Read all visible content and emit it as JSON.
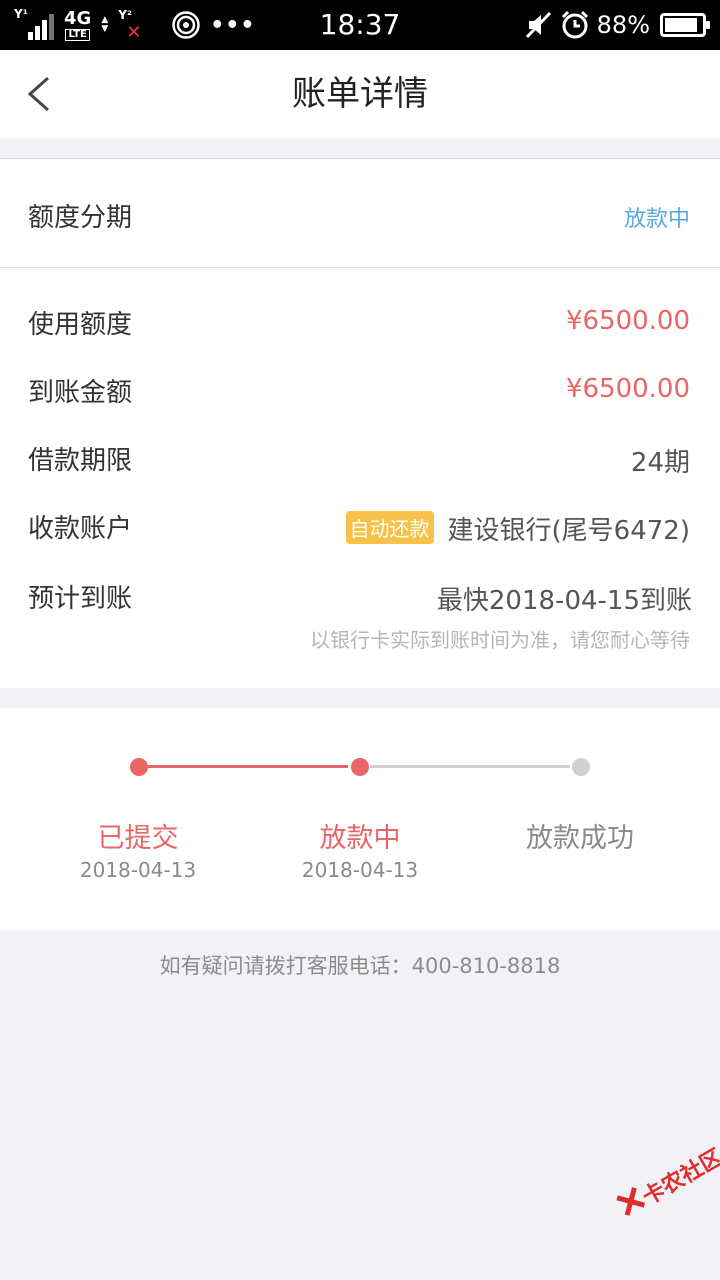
{
  "status_bar": {
    "time": "18:37",
    "network": "4G",
    "network_sub": "LTE",
    "battery": "88%",
    "battery_level": 0.88
  },
  "header": {
    "title": "账单详情"
  },
  "summary": {
    "type_label": "额度分期",
    "status": "放款中"
  },
  "details": {
    "used_label": "使用额度",
    "used_value": "¥6500.00",
    "received_label": "到账金额",
    "received_value": "¥6500.00",
    "term_label": "借款期限",
    "term_value": "24期",
    "account_label": "收款账户",
    "account_tag": "自动还款",
    "account_value": "建设银行(尾号6472)",
    "eta_label": "预计到账",
    "eta_value": "最快2018-04-15到账",
    "eta_note": "以银行卡实际到账时间为准，请您耐心等待"
  },
  "progress": {
    "steps": [
      {
        "label": "已提交",
        "date": "2018-04-13"
      },
      {
        "label": "放款中",
        "date": "2018-04-13"
      },
      {
        "label": "放款成功",
        "date": ""
      }
    ]
  },
  "footer": {
    "hotline": "如有疑问请拨打客服电话：400-810-8818"
  },
  "watermark": {
    "text": "卡农社区"
  },
  "colors": {
    "accent_red": "#ea6565",
    "status_blue": "#5ba8e0",
    "tag_yellow": "#f7c24a",
    "inactive_gray": "#d0d0d0"
  }
}
